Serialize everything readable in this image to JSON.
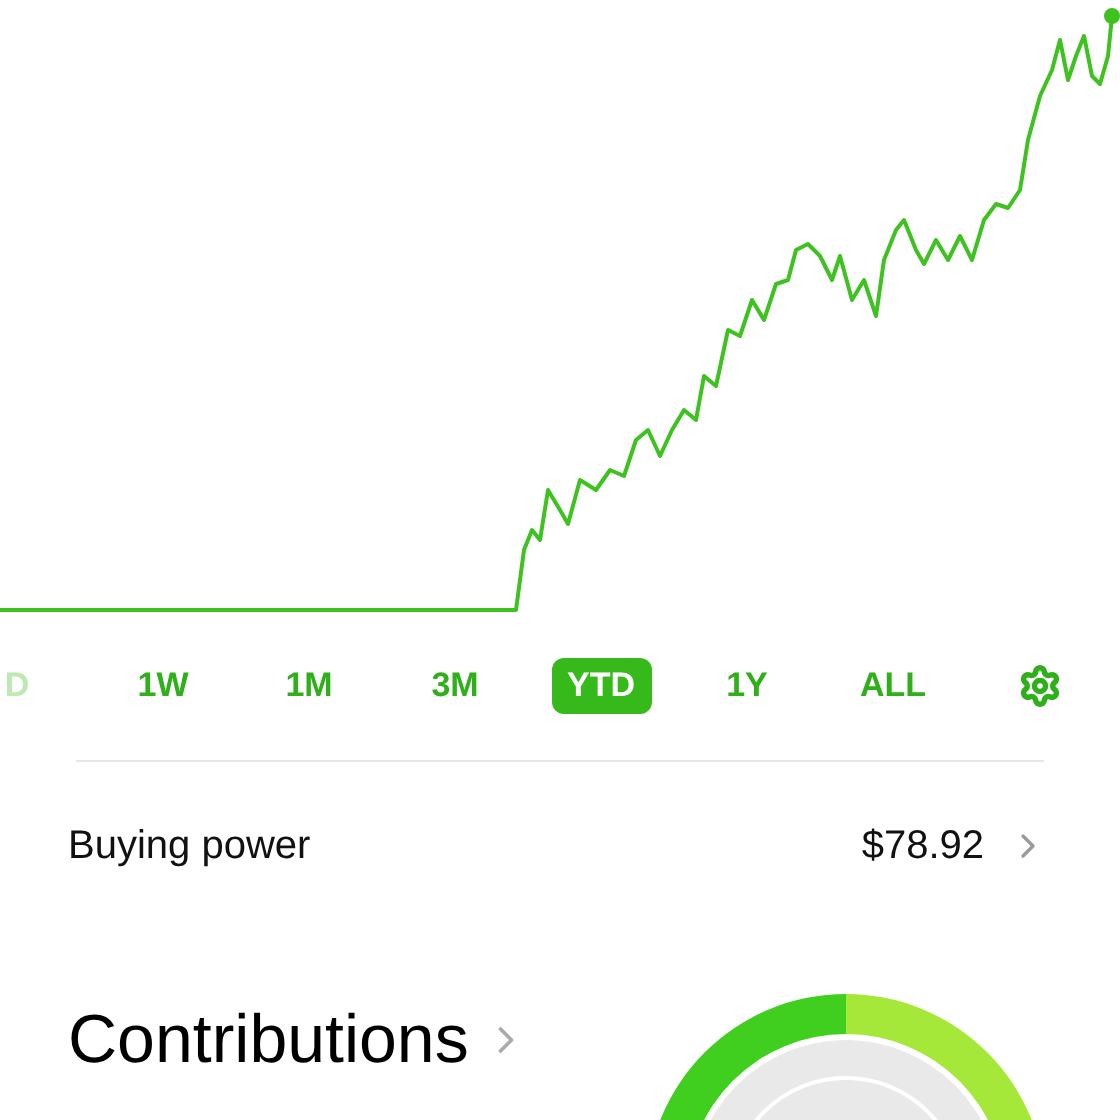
{
  "ranges": [
    {
      "label": "D",
      "selected": false
    },
    {
      "label": "1W",
      "selected": false
    },
    {
      "label": "1M",
      "selected": false
    },
    {
      "label": "3M",
      "selected": false
    },
    {
      "label": "YTD",
      "selected": true
    },
    {
      "label": "1Y",
      "selected": false
    },
    {
      "label": "ALL",
      "selected": false
    }
  ],
  "buying_power": {
    "label": "Buying power",
    "value": "$78.92"
  },
  "contributions": {
    "title": "Contributions"
  }
}
